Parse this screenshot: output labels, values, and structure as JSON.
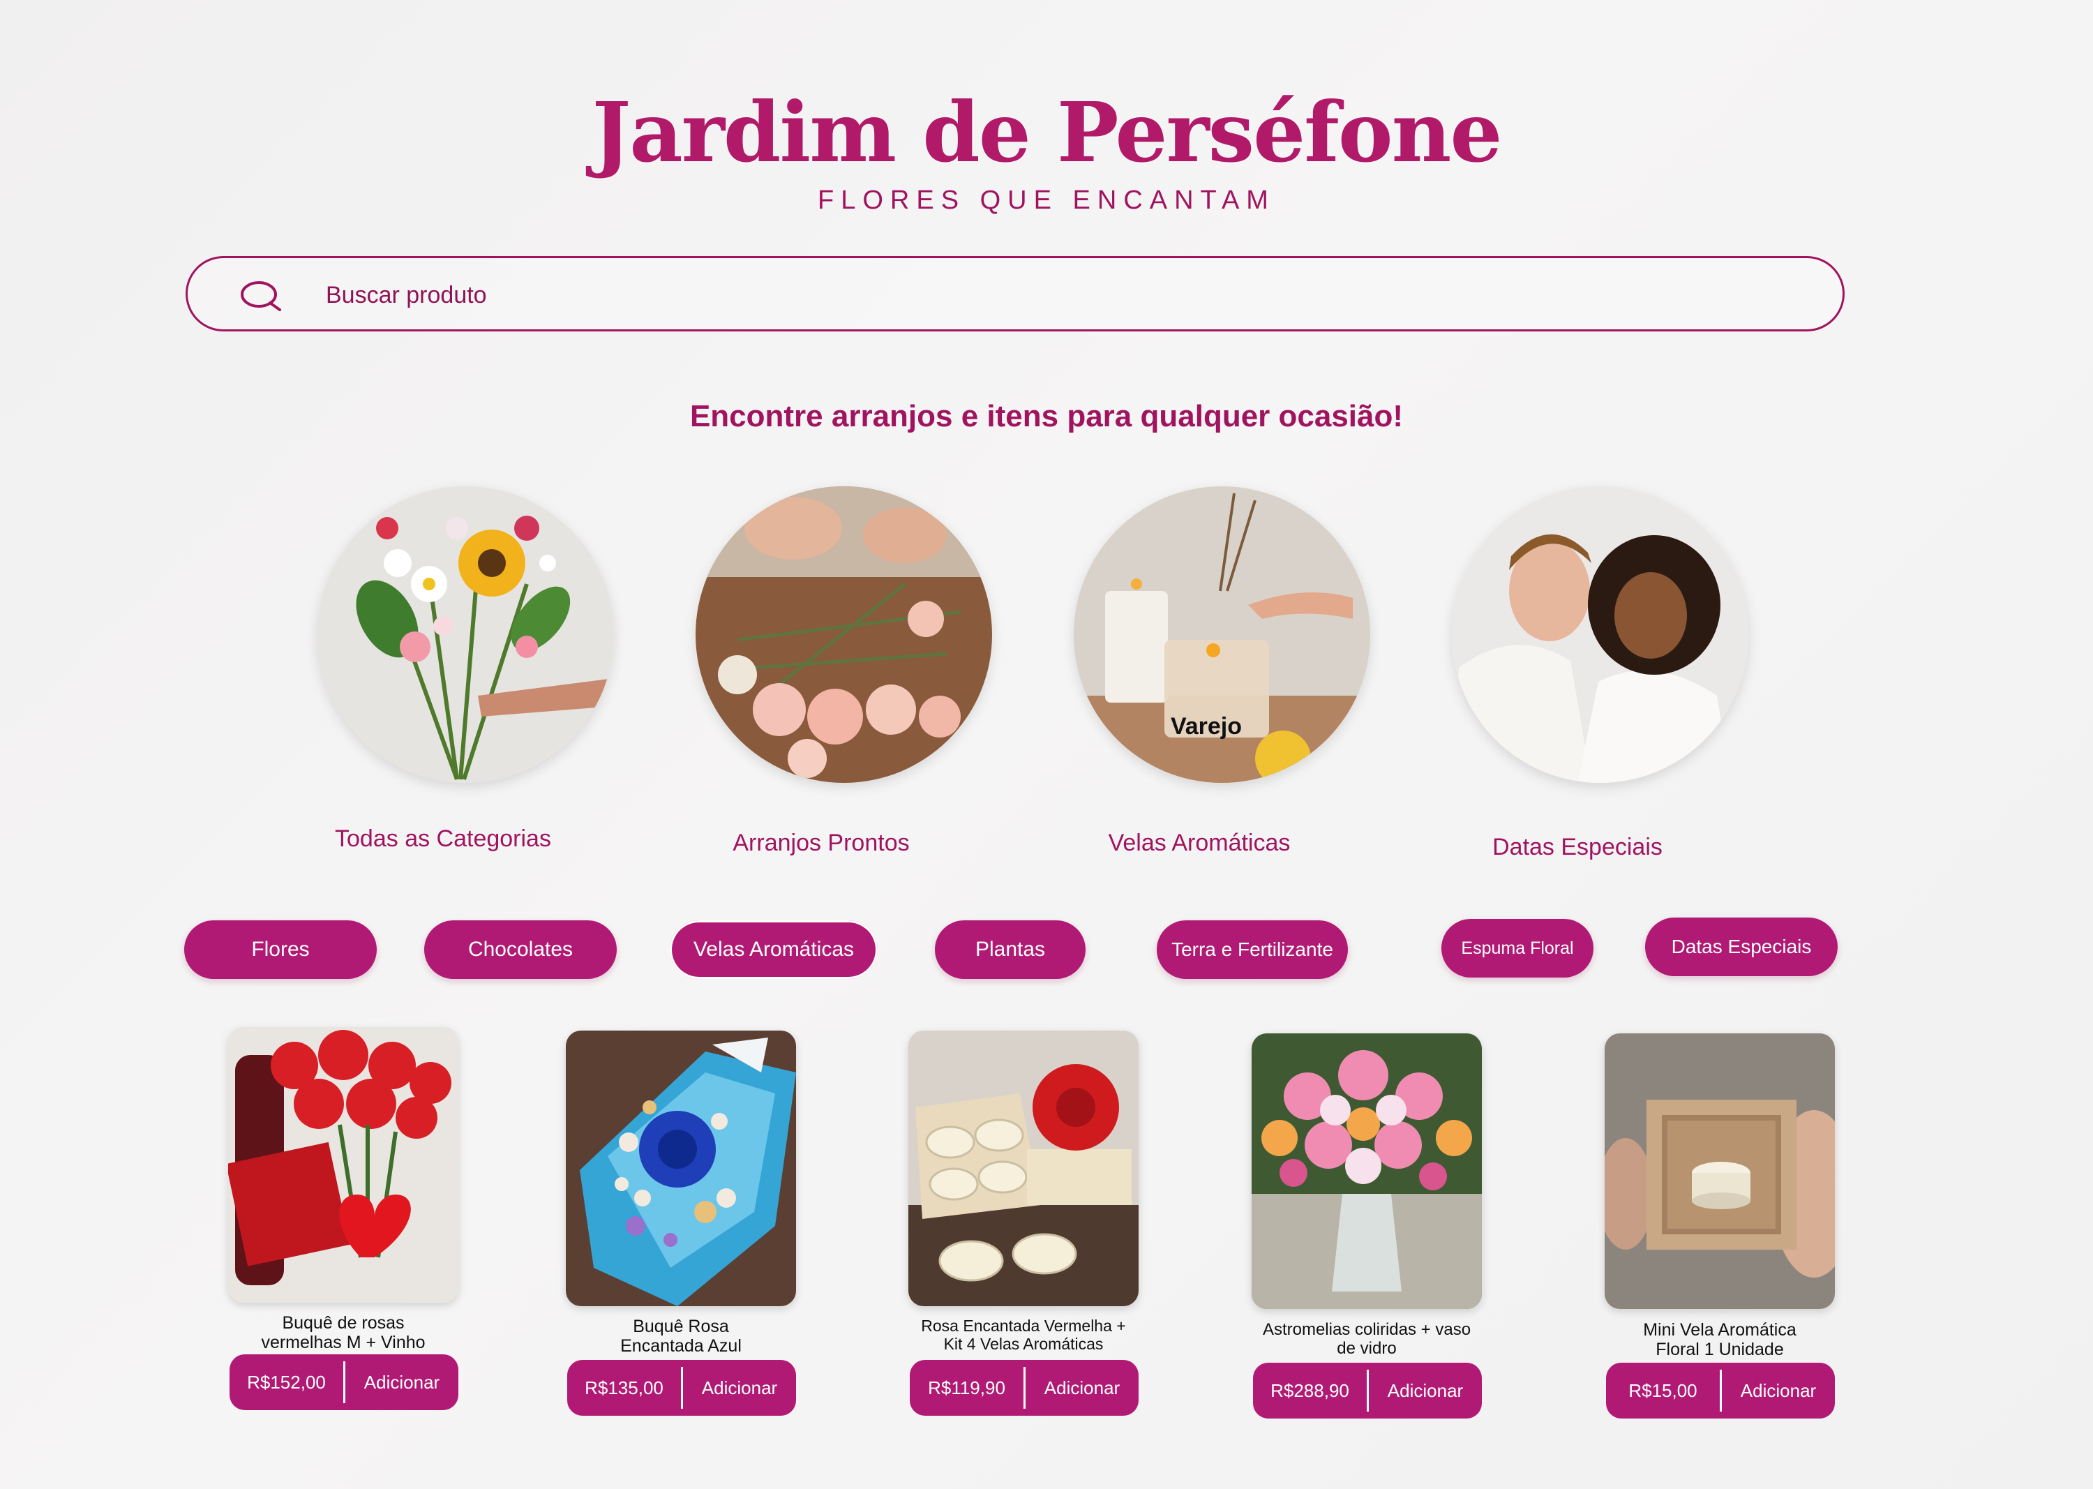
{
  "brand": {
    "title": "Jardim de Perséfone",
    "subtitle": "FLORES QUE ENCANTAM"
  },
  "search": {
    "placeholder": "Buscar produto"
  },
  "tagline": "Encontre arranjos e itens para qualquer ocasião!",
  "categories": [
    {
      "label": "Todas as Categorias"
    },
    {
      "label": "Arranjos Prontos"
    },
    {
      "label": "Velas Aromáticas",
      "overlay": "Varejo"
    },
    {
      "label": "Datas Especiais"
    }
  ],
  "filters": [
    "Flores",
    "Chocolates",
    "Velas Aromáticas",
    "Plantas",
    "Terra e Fertilizante",
    "Espuma Floral",
    "Datas Especiais"
  ],
  "products": [
    {
      "name_line1": "Buquê de rosas",
      "name_line2": "vermelhas M + Vinho",
      "price": "R$152,00",
      "action": "Adicionar"
    },
    {
      "name_line1": "Buquê Rosa",
      "name_line2": "Encantada Azul",
      "price": "R$135,00",
      "action": "Adicionar"
    },
    {
      "name_line1": "Rosa Encantada Vermelha +",
      "name_line2": "Kit 4 Velas Aromáticas",
      "price": "R$119,90",
      "action": "Adicionar"
    },
    {
      "name_line1": "Astromelias coliridas + vaso",
      "name_line2": "de vidro",
      "price": "R$288,90",
      "action": "Adicionar"
    },
    {
      "name_line1": "Mini Vela Aromática",
      "name_line2": "Floral 1 Unidade",
      "price": "R$15,00",
      "action": "Adicionar"
    }
  ],
  "colors": {
    "brand": "#b11a69",
    "accent": "#b11a74",
    "background": "#f3f2f2"
  }
}
